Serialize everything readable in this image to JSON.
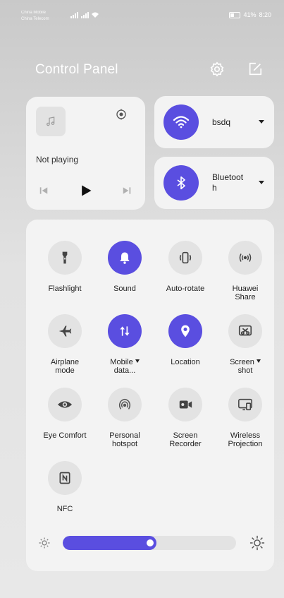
{
  "status_bar": {
    "carrier_1": "China Mobile",
    "carrier_2": "China Telecom",
    "battery": "41%",
    "time": "8:20"
  },
  "header": {
    "title": "Control Panel",
    "settings_icon": "gear-icon",
    "edit_icon": "edit-icon"
  },
  "media": {
    "status": "Not playing",
    "icons": [
      "music-note-icon",
      "cast-icon",
      "previous-icon",
      "play-icon",
      "next-icon"
    ]
  },
  "wifi": {
    "label": "bsdq",
    "icon": "wifi-icon"
  },
  "bluetooth": {
    "label": "Bluetoot h",
    "label_line1": "Bluetoot",
    "label_line2": "h",
    "icon": "bluetooth-icon"
  },
  "toggles": [
    {
      "line1": "Flashlight",
      "line2": "",
      "on": false,
      "dropdown": false,
      "icon": "flashlight-icon"
    },
    {
      "line1": "Sound",
      "line2": "",
      "on": true,
      "dropdown": false,
      "icon": "bell-icon"
    },
    {
      "line1": "Auto-rotate",
      "line2": "",
      "on": false,
      "dropdown": false,
      "icon": "auto-rotate-icon"
    },
    {
      "line1": "Huawei",
      "line2": "Share",
      "on": false,
      "dropdown": false,
      "icon": "huawei-share-icon"
    },
    {
      "line1": "Airplane",
      "line2": "mode",
      "on": false,
      "dropdown": false,
      "icon": "airplane-icon"
    },
    {
      "line1": "Mobile",
      "line2": "data...",
      "on": true,
      "dropdown": true,
      "icon": "mobile-data-icon"
    },
    {
      "line1": "Location",
      "line2": "",
      "on": true,
      "dropdown": false,
      "icon": "location-pin-icon"
    },
    {
      "line1": "Screen",
      "line2": "shot",
      "on": false,
      "dropdown": true,
      "icon": "screenshot-icon"
    },
    {
      "line1": "Eye Comfort",
      "line2": "",
      "on": false,
      "dropdown": false,
      "icon": "eye-icon"
    },
    {
      "line1": "Personal",
      "line2": "hotspot",
      "on": false,
      "dropdown": false,
      "icon": "hotspot-icon"
    },
    {
      "line1": "Screen",
      "line2": "Recorder",
      "on": false,
      "dropdown": false,
      "icon": "screen-recorder-icon"
    },
    {
      "line1": "Wireless",
      "line2": "Projection",
      "on": false,
      "dropdown": false,
      "icon": "wireless-projection-icon"
    },
    {
      "line1": "NFC",
      "line2": "",
      "on": false,
      "dropdown": false,
      "icon": "nfc-icon"
    }
  ],
  "brightness": {
    "level": 0.5,
    "icons": [
      "sun-low-icon",
      "sun-high-icon"
    ]
  },
  "colors": {
    "accent": "#5a4ee0",
    "card": "#f3f3f3",
    "tile_off": "#e3e3e3"
  }
}
